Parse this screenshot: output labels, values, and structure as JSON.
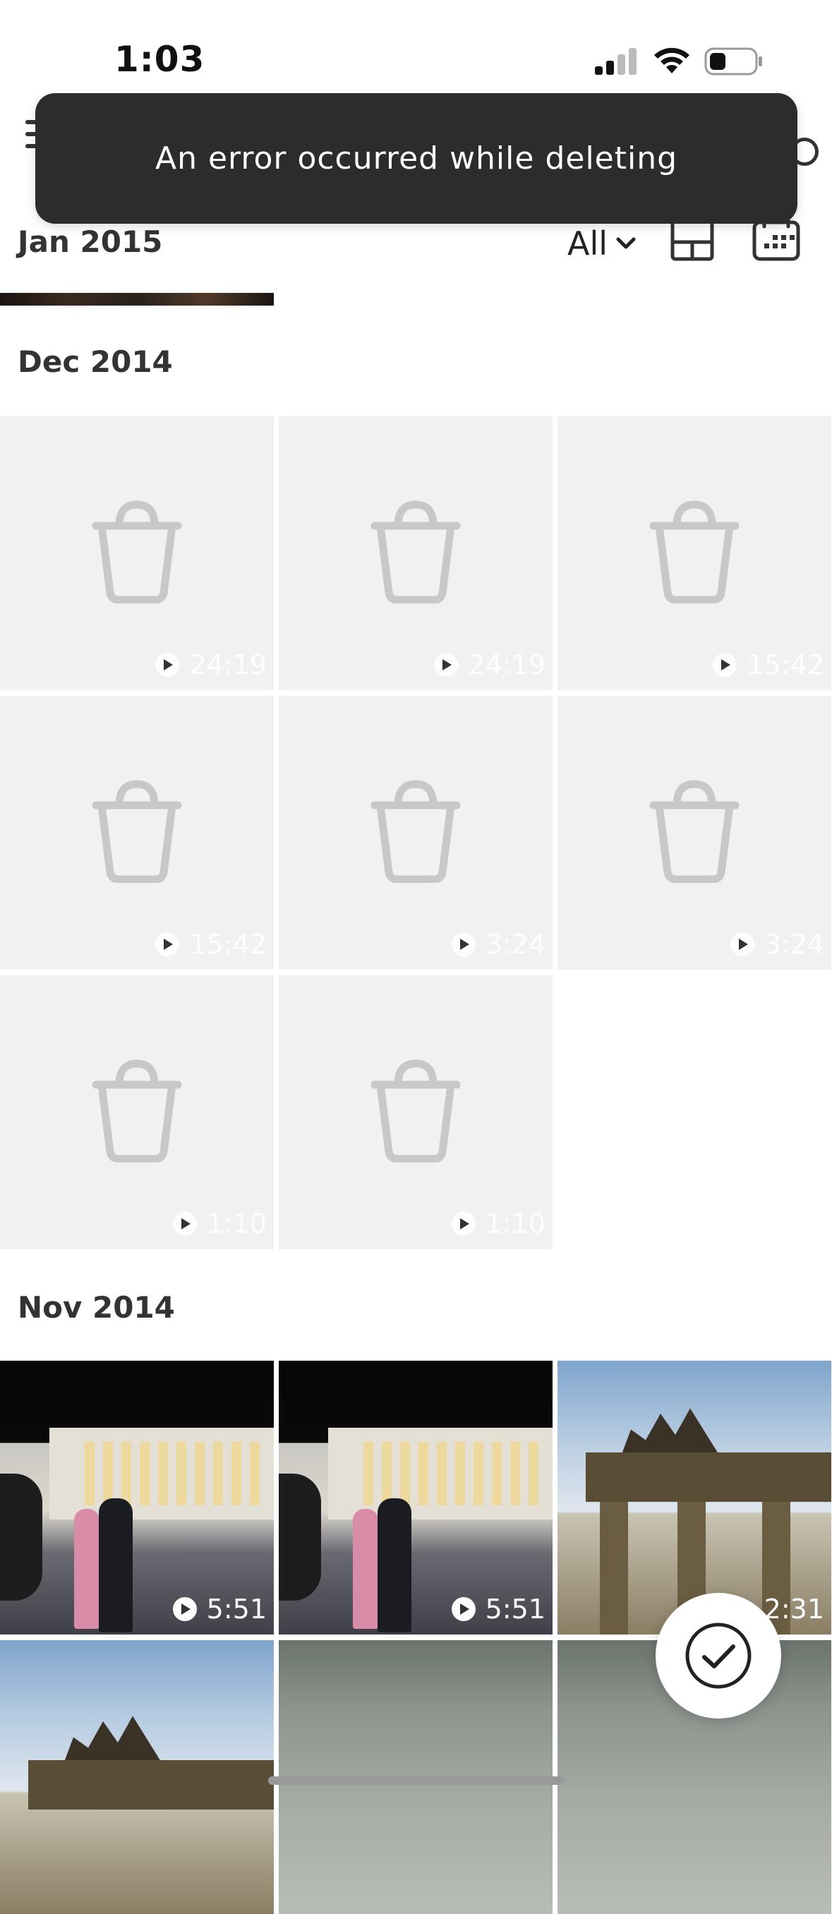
{
  "status_bar": {
    "time": "1:03"
  },
  "toast": {
    "message": "An error occurred while deleting"
  },
  "controls": {
    "filter_label": "All"
  },
  "sections": [
    {
      "title": "Jan 2015"
    },
    {
      "title": "Dec 2014"
    },
    {
      "title": "Nov 2014"
    }
  ],
  "dec_2014_items": [
    {
      "duration": "24:19",
      "state": "deleted"
    },
    {
      "duration": "24:19",
      "state": "deleted"
    },
    {
      "duration": "15:42",
      "state": "deleted"
    },
    {
      "duration": "15:42",
      "state": "deleted"
    },
    {
      "duration": "3:24",
      "state": "deleted"
    },
    {
      "duration": "3:24",
      "state": "deleted"
    },
    {
      "duration": "1:10",
      "state": "deleted"
    },
    {
      "duration": "1:10",
      "state": "deleted"
    }
  ],
  "nov_2014_items": [
    {
      "duration": "5:51"
    },
    {
      "duration": "5:51"
    },
    {
      "duration": "2:31"
    }
  ],
  "colors": {
    "toast_bg": "#2c2c2c",
    "placeholder_icon": "#c8c8c8"
  },
  "icons": [
    "menu-icon",
    "filter-chevron-icon",
    "layout-toggle-icon",
    "calendar-icon",
    "trash-icon",
    "play-icon",
    "checkmark-icon",
    "signal-icon",
    "wifi-icon",
    "battery-icon"
  ]
}
